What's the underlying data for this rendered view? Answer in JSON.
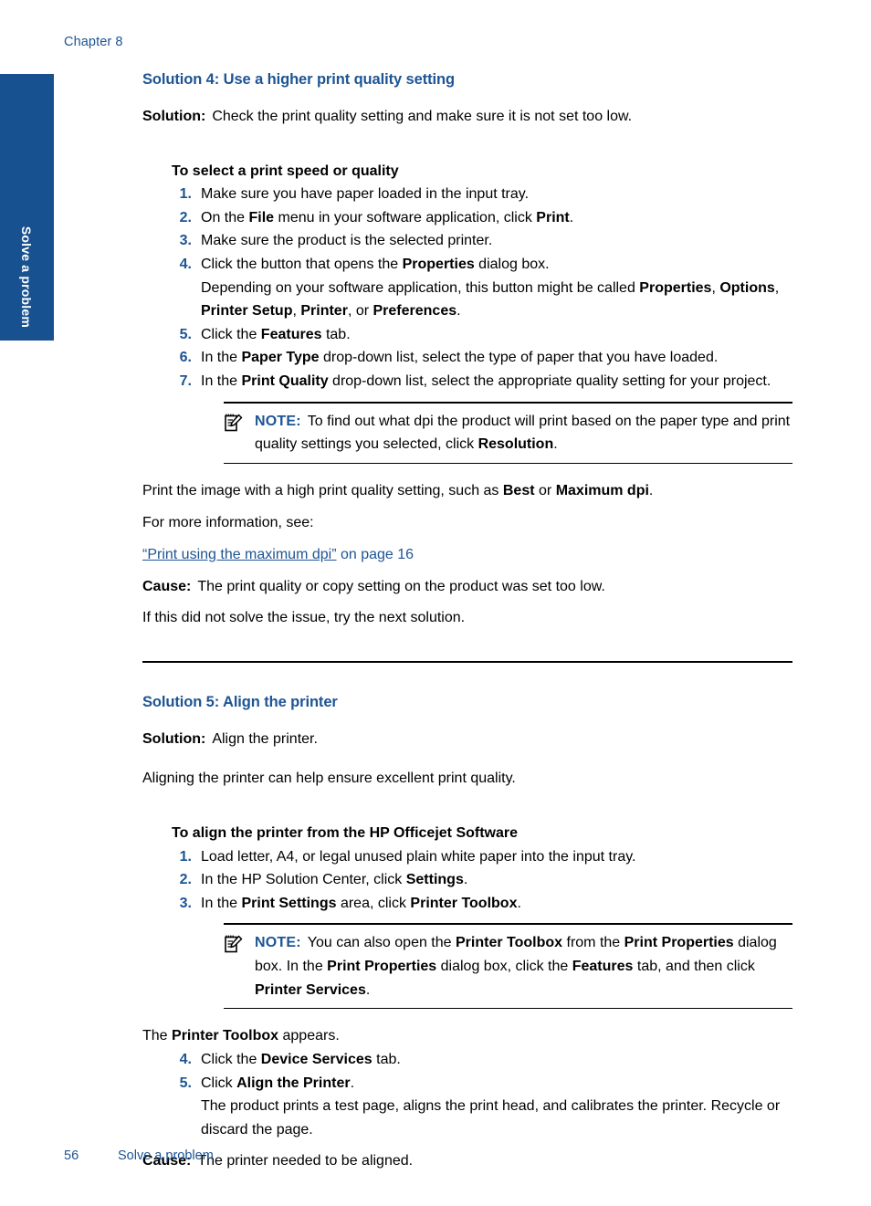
{
  "header": {
    "chapter": "Chapter 8"
  },
  "side_tab": {
    "label": "Solve a problem",
    "color": "#17518f"
  },
  "colors": {
    "heading_blue": "#1d5493",
    "link_blue": "#1d5493",
    "tab_blue": "#17518f",
    "text": "#000000"
  },
  "sections": [
    {
      "id": "solution-4",
      "heading": "Solution 4: Use a higher print quality setting",
      "solution_label": "Solution:",
      "solution_text": "Check the print quality setting and make sure it is not set too low.",
      "procedure_heading": "To select a print speed or quality",
      "steps": [
        {
          "num": "1.",
          "text": "Make sure you have paper loaded in the input tray."
        },
        {
          "num": "2.",
          "text": "On the File menu in your software application, click Print."
        },
        {
          "num": "3.",
          "text": "Make sure the product is the selected printer."
        },
        {
          "num": "4.",
          "text": "Click the button that opens the Properties dialog box.",
          "sub": "Depending on your software application, this button might be called Properties, Options, Printer Setup, Printer, or Preferences."
        },
        {
          "num": "5.",
          "text": "Click the Features tab."
        },
        {
          "num": "6.",
          "text": "In the Paper Type drop-down list, select the type of paper that you have loaded."
        },
        {
          "num": "7.",
          "text": "In the Print Quality drop-down list, select the appropriate quality setting for your project."
        }
      ],
      "note": {
        "label": "NOTE:",
        "text": "To find out what dpi the product will print based on the paper type and print quality settings you selected, click Resolution.",
        "icon": "note-pencil-icon"
      },
      "after_note": [
        "Print the image with a high print quality setting, such as Best or Maximum dpi.",
        "For more information, see:"
      ],
      "link": {
        "quoted": "“Print using the maximum dpi”",
        "suffix": " on page 16"
      },
      "cause_label": "Cause:",
      "cause_text": "The print quality or copy setting on the product was set too low.",
      "trailer": "If this did not solve the issue, try the next solution."
    },
    {
      "id": "solution-5",
      "heading": "Solution 5: Align the printer",
      "solution_label": "Solution:",
      "solution_text": "Align the printer.",
      "intro": "Aligning the printer can help ensure excellent print quality.",
      "procedure_heading": "To align the printer from the HP Officejet Software",
      "steps_a": [
        {
          "num": "1.",
          "text": "Load letter, A4, or legal unused plain white paper into the input tray."
        },
        {
          "num": "2.",
          "text": "In the HP Solution Center, click Settings."
        },
        {
          "num": "3.",
          "text": "In the Print Settings area, click Printer Toolbox."
        }
      ],
      "note": {
        "label": "NOTE:",
        "text": "You can also open the Printer Toolbox from the Print Properties dialog box. In the Print Properties dialog box, click the Features tab, and then click Printer Services.",
        "icon": "note-pencil-icon"
      },
      "after_note": "The Printer Toolbox appears.",
      "steps_b": [
        {
          "num": "4.",
          "text": "Click the Device Services tab."
        },
        {
          "num": "5.",
          "text": "Click Align the Printer.",
          "sub": "The product prints a test page, aligns the print head, and calibrates the printer. Recycle or discard the page."
        }
      ],
      "cause_label": "Cause:",
      "cause_text": "The printer needed to be aligned."
    }
  ],
  "footer": {
    "page_number": "56",
    "section_name": "Solve a problem"
  }
}
